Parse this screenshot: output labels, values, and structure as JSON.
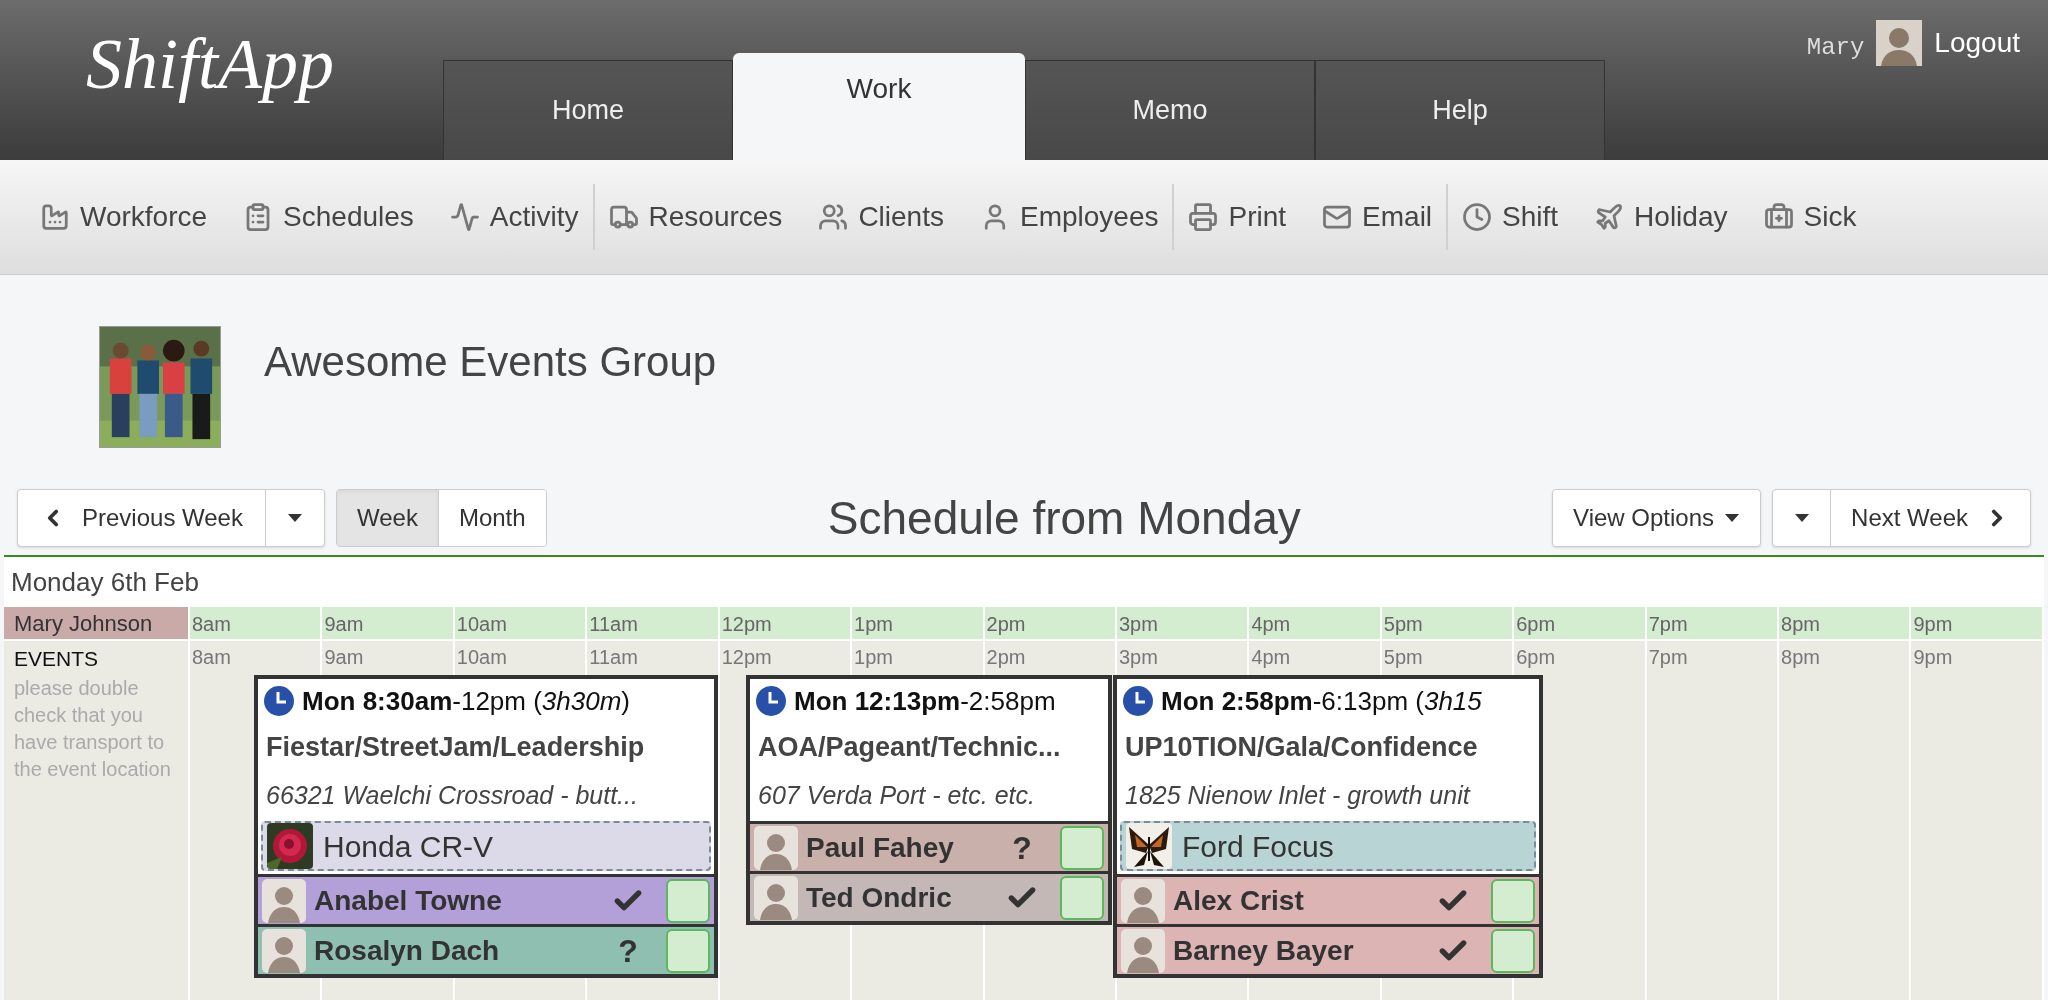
{
  "header": {
    "logo": "ShiftApp",
    "tabs": [
      {
        "label": "Home",
        "selected": false
      },
      {
        "label": "Work",
        "selected": true
      },
      {
        "label": "Memo",
        "selected": false
      },
      {
        "label": "Help",
        "selected": false
      }
    ],
    "user": "Mary",
    "logout": "Logout"
  },
  "toolbar": {
    "groups": [
      [
        {
          "label": "Workforce"
        },
        {
          "label": "Schedules"
        },
        {
          "label": "Activity"
        }
      ],
      [
        {
          "label": "Resources"
        },
        {
          "label": "Clients"
        },
        {
          "label": "Employees"
        }
      ],
      [
        {
          "label": "Print"
        },
        {
          "label": "Email"
        }
      ],
      [
        {
          "label": "Shift"
        },
        {
          "label": "Holiday"
        },
        {
          "label": "Sick"
        }
      ]
    ]
  },
  "company": {
    "name": "Awesome Events Group"
  },
  "nav": {
    "previous": "Previous Week",
    "views": [
      {
        "label": "Week",
        "selected": true
      },
      {
        "label": "Month",
        "selected": false
      }
    ],
    "title": "Schedule from Monday",
    "view_options": "View Options",
    "next": "Next Week"
  },
  "schedule": {
    "date": "Monday 6th Feb",
    "employee": "Mary Johnson",
    "hours": [
      "8am",
      "9am",
      "10am",
      "11am",
      "12pm",
      "1pm",
      "2pm",
      "3pm",
      "4pm",
      "5pm",
      "6pm",
      "7pm",
      "8pm",
      "9pm"
    ],
    "events_label": "EVENTS",
    "events_note": "please double check that you have transport to the event location",
    "event_hours": [
      "8am",
      "9am",
      "10am",
      "11am",
      "12pm",
      "1pm",
      "2pm",
      "3pm",
      "4pm",
      "5pm",
      "6pm",
      "7pm",
      "8pm",
      "9pm"
    ],
    "shifts": [
      {
        "time": "**Mon 8:30am**-12pm (*3h30m*)",
        "title": "Fiestar/StreetJam/Leadership",
        "address": "66321 Waelchi Crossroad - butt...",
        "resource": {
          "name": "Honda CR-V",
          "color": "#dcdae8"
        },
        "staff": [
          {
            "name": "Anabel Towne",
            "confirmed": true,
            "checked": false,
            "color": "#b3a0d8"
          },
          {
            "name": "Rosalyn Dach",
            "confirmed": false,
            "mark": "?",
            "checked": false,
            "color": "#8fbfb0"
          }
        ]
      },
      {
        "time": "**Mon 12:13pm**-2:58pm",
        "title": "AOA/Pageant/Technic...",
        "address": "607 Verda Port - etc. etc.",
        "staff": [
          {
            "name": "Paul Fahey",
            "confirmed": false,
            "mark": "?",
            "checked": false,
            "color": "#c9b0ab"
          },
          {
            "name": "Ted Ondric",
            "confirmed": true,
            "checked": false,
            "color": "#c4b8b6"
          }
        ]
      },
      {
        "time": "**Mon 2:58pm**-6:13pm (*3h15*",
        "title": "UP10TION/Gala/Confidence",
        "address": "1825 Nienow Inlet - growth unit",
        "resource": {
          "name": "Ford Focus",
          "color": "#b8d4d4"
        },
        "staff": [
          {
            "name": "Alex Crist",
            "confirmed": true,
            "checked": false,
            "color": "#dcb4b4"
          },
          {
            "name": "Barney Bayer",
            "confirmed": true,
            "checked": false,
            "color": "#dcb4b4"
          }
        ]
      }
    ]
  }
}
